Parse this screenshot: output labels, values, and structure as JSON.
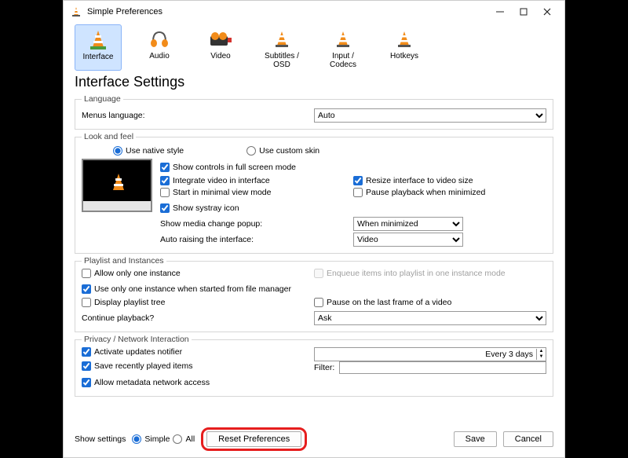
{
  "window": {
    "title": "Simple Preferences"
  },
  "tabs": [
    {
      "label": "Interface"
    },
    {
      "label": "Audio"
    },
    {
      "label": "Video"
    },
    {
      "label": "Subtitles / OSD"
    },
    {
      "label": "Input / Codecs"
    },
    {
      "label": "Hotkeys"
    }
  ],
  "page_title": "Interface Settings",
  "groups": {
    "language": {
      "legend": "Language",
      "menus_label": "Menus language:",
      "menus_value": "Auto"
    },
    "look": {
      "legend": "Look and feel",
      "native": "Use native style",
      "custom": "Use custom skin",
      "fullscreen": "Show controls in full screen mode",
      "integrate": "Integrate video in interface",
      "resize": "Resize interface to video size",
      "minimal": "Start in minimal view mode",
      "pause_min": "Pause playback when minimized",
      "systray": "Show systray icon",
      "media_popup_label": "Show media change popup:",
      "media_popup_value": "When minimized",
      "auto_raise_label": "Auto raising the interface:",
      "auto_raise_value": "Video"
    },
    "playlist": {
      "legend": "Playlist and Instances",
      "one_instance": "Allow only one instance",
      "enqueue": "Enqueue items into playlist in one instance mode",
      "one_from_fm": "Use only one instance when started from file manager",
      "display_tree": "Display playlist tree",
      "pause_last": "Pause on the last frame of a video",
      "continue_label": "Continue playback?",
      "continue_value": "Ask"
    },
    "privacy": {
      "legend": "Privacy / Network Interaction",
      "updates": "Activate updates notifier",
      "updates_interval": "Every 3 days",
      "recent": "Save recently played items",
      "filter_label": "Filter:",
      "metadata": "Allow metadata network access"
    }
  },
  "footer": {
    "show_settings": "Show settings",
    "simple": "Simple",
    "all": "All",
    "reset": "Reset Preferences",
    "save": "Save",
    "cancel": "Cancel"
  }
}
